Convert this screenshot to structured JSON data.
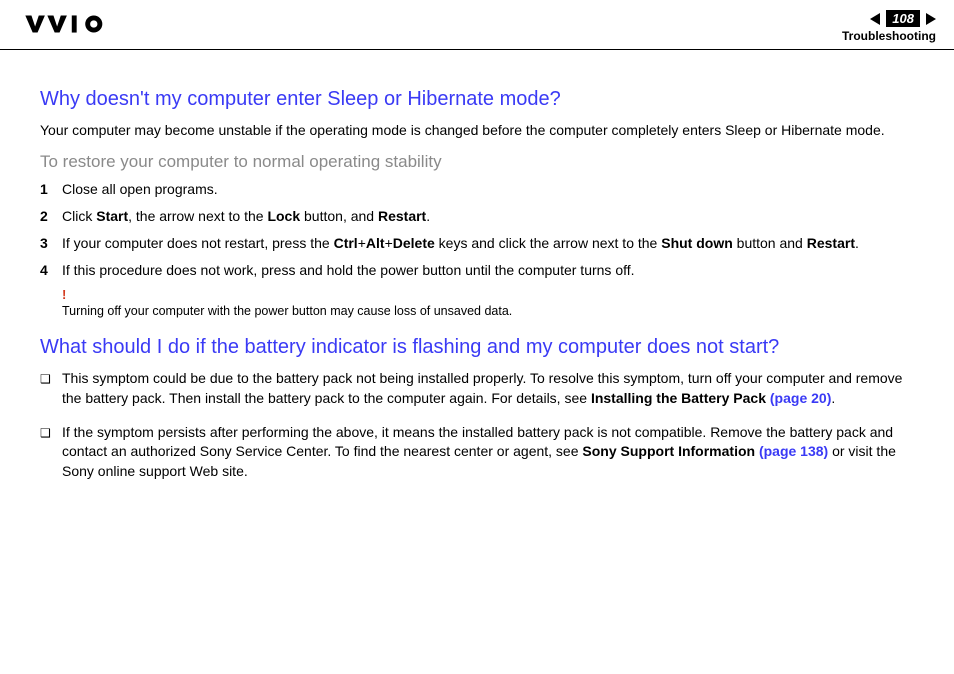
{
  "header": {
    "page_number": "108",
    "section": "Troubleshooting"
  },
  "q1": {
    "title": "Why doesn't my computer enter Sleep or Hibernate mode?",
    "intro": "Your computer may become unstable if the operating mode is changed before the computer completely enters Sleep or Hibernate mode.",
    "subhead": "To restore your computer to normal operating stability",
    "steps": {
      "s1": {
        "n": "1",
        "text": "Close all open programs."
      },
      "s2": {
        "n": "2",
        "pre": "Click ",
        "b1": "Start",
        "mid1": ", the arrow next to the ",
        "b2": "Lock",
        "mid2": " button, and ",
        "b3": "Restart",
        "post": "."
      },
      "s3": {
        "n": "3",
        "pre": "If your computer does not restart, press the ",
        "b1": "Ctrl",
        "plus1": "+",
        "b2": "Alt",
        "plus2": "+",
        "b3": "Delete",
        "mid": " keys and click the arrow next to the ",
        "b4": "Shut down",
        "mid2": " button and ",
        "b5": "Restart",
        "post": "."
      },
      "s4": {
        "n": "4",
        "text": "If this procedure does not work, press and hold the power button until the computer turns off."
      }
    },
    "note": {
      "bang": "!",
      "text": "Turning off your computer with the power button may cause loss of unsaved data."
    }
  },
  "q2": {
    "title": "What should I do if the battery indicator is flashing and my computer does not start?",
    "b1": {
      "pre": "This symptom could be due to the battery pack not being installed properly. To resolve this symptom, turn off your computer and remove the battery pack. Then install the battery pack to the computer again. For details, see ",
      "bold": "Installing the Battery Pack ",
      "link": "(page 20)",
      "post": "."
    },
    "b2": {
      "pre": "If the symptom persists after performing the above, it means the installed battery pack is not compatible. Remove the battery pack and contact an authorized Sony Service Center. To find the nearest center or agent, see ",
      "bold": "Sony Support Information ",
      "link": "(page 138)",
      "post": " or visit the Sony online support Web site."
    }
  }
}
